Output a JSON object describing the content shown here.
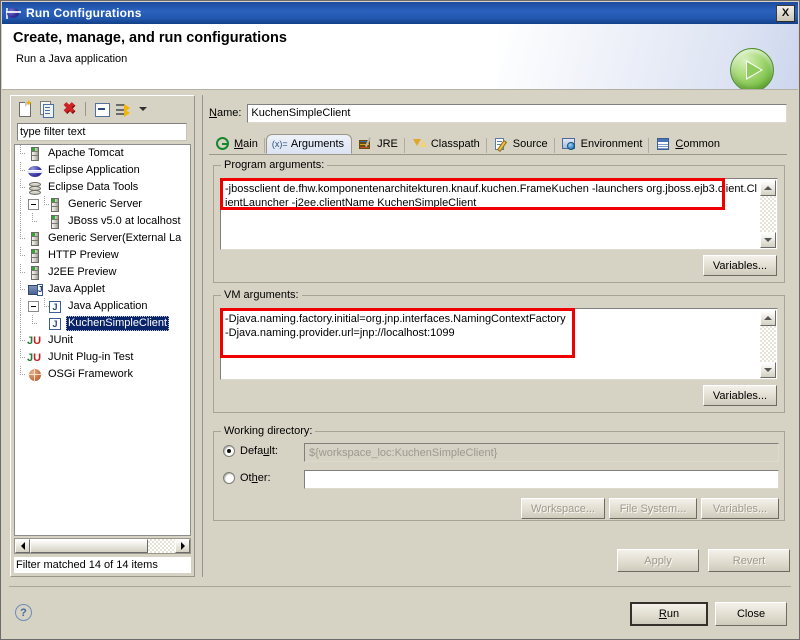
{
  "window": {
    "title": "Run Configurations",
    "close_label": "X"
  },
  "header": {
    "title": "Create, manage, and run configurations",
    "subtitle": "Run a Java application",
    "run_icon": "run-green-play-icon"
  },
  "tree_panel": {
    "toolbar": [
      {
        "name": "new-configuration-icon"
      },
      {
        "name": "duplicate-configuration-icon"
      },
      {
        "name": "delete-configuration-icon",
        "glyph": "✖"
      },
      {
        "name": "collapse-all-icon"
      },
      {
        "name": "filter-options-icon"
      },
      {
        "name": "chevron-down-icon"
      }
    ],
    "filter": {
      "value": "type filter text",
      "placeholder": "type filter text"
    },
    "items": [
      {
        "label": "Apache Tomcat",
        "icon": "server-icon",
        "indent": 1,
        "expander": false,
        "selected": false
      },
      {
        "label": "Eclipse Application",
        "icon": "eclipse-icon",
        "indent": 1,
        "expander": false,
        "selected": false
      },
      {
        "label": "Eclipse Data Tools",
        "icon": "database-icon",
        "indent": 1,
        "expander": false,
        "selected": false
      },
      {
        "label": "Generic Server",
        "icon": "server-icon",
        "indent": 0,
        "expander": true,
        "selected": false
      },
      {
        "label": "JBoss v5.0 at localhost",
        "icon": "server-icon",
        "indent": 2,
        "expander": false,
        "selected": false
      },
      {
        "label": "Generic Server(External La",
        "icon": "server-icon",
        "indent": 1,
        "expander": false,
        "selected": false
      },
      {
        "label": "HTTP Preview",
        "icon": "server-icon",
        "indent": 1,
        "expander": false,
        "selected": false
      },
      {
        "label": "J2EE Preview",
        "icon": "server-icon",
        "indent": 1,
        "expander": false,
        "selected": false
      },
      {
        "label": "Java Applet",
        "icon": "java-applet-icon",
        "indent": 1,
        "expander": false,
        "selected": false
      },
      {
        "label": "Java Application",
        "icon": "java-app-icon",
        "indent": 0,
        "expander": true,
        "selected": false
      },
      {
        "label": "KuchenSimpleClient",
        "icon": "java-app-icon",
        "indent": 2,
        "expander": false,
        "selected": true
      },
      {
        "label": "JUnit",
        "icon": "junit-icon",
        "indent": 1,
        "expander": false,
        "selected": false
      },
      {
        "label": "JUnit Plug-in Test",
        "icon": "junit-plugin-icon",
        "indent": 1,
        "expander": false,
        "selected": false
      },
      {
        "label": "OSGi Framework",
        "icon": "osgi-icon",
        "indent": 1,
        "expander": false,
        "selected": false
      }
    ],
    "status": "Filter matched 14 of 14 items"
  },
  "config": {
    "name_label": "Name:",
    "name_value": "KuchenSimpleClient",
    "tabs": [
      {
        "label": "Main",
        "icon": "main-icon",
        "active": false
      },
      {
        "label": "Arguments",
        "icon": "arguments-icon",
        "active": true
      },
      {
        "label": "JRE",
        "icon": "jre-icon",
        "active": false
      },
      {
        "label": "Classpath",
        "icon": "classpath-icon",
        "active": false
      },
      {
        "label": "Source",
        "icon": "source-icon",
        "active": false
      },
      {
        "label": "Environment",
        "icon": "environment-icon",
        "active": false
      },
      {
        "label": "Common",
        "icon": "common-icon",
        "active": false
      }
    ],
    "program_arguments": {
      "group_title": "Program arguments:",
      "value": "-jbossclient de.fhw.komponentenarchitekturen.knauf.kuchen.FrameKuchen -launchers org.jboss.ejb3.client.ClientLauncher -j2ee.clientName KuchenSimpleClient",
      "variables_button": "Variables..."
    },
    "vm_arguments": {
      "group_title": "VM arguments:",
      "value": "-Djava.naming.factory.initial=org.jnp.interfaces.NamingContextFactory\n-Djava.naming.provider.url=jnp://localhost:1099",
      "variables_button": "Variables..."
    },
    "working_directory": {
      "group_title": "Working directory:",
      "default_label": "Default:",
      "default_value": "${workspace_loc:KuchenSimpleClient}",
      "default_selected": true,
      "other_label": "Other:",
      "other_value": "",
      "other_selected": false,
      "workspace_button": "Workspace...",
      "filesystem_button": "File System...",
      "variables_button": "Variables..."
    },
    "apply_button": "Apply",
    "revert_button": "Revert"
  },
  "footer": {
    "help_icon": "help-icon",
    "help_glyph": "?",
    "run_button": "Run",
    "close_button": "Close"
  },
  "colors": {
    "titlebar_blue": "#2257ad",
    "selection_blue": "#0a246a",
    "highlight_red": "#ee0000",
    "dialog_bg": "#d6d2c4",
    "run_green": "#74bd42"
  }
}
